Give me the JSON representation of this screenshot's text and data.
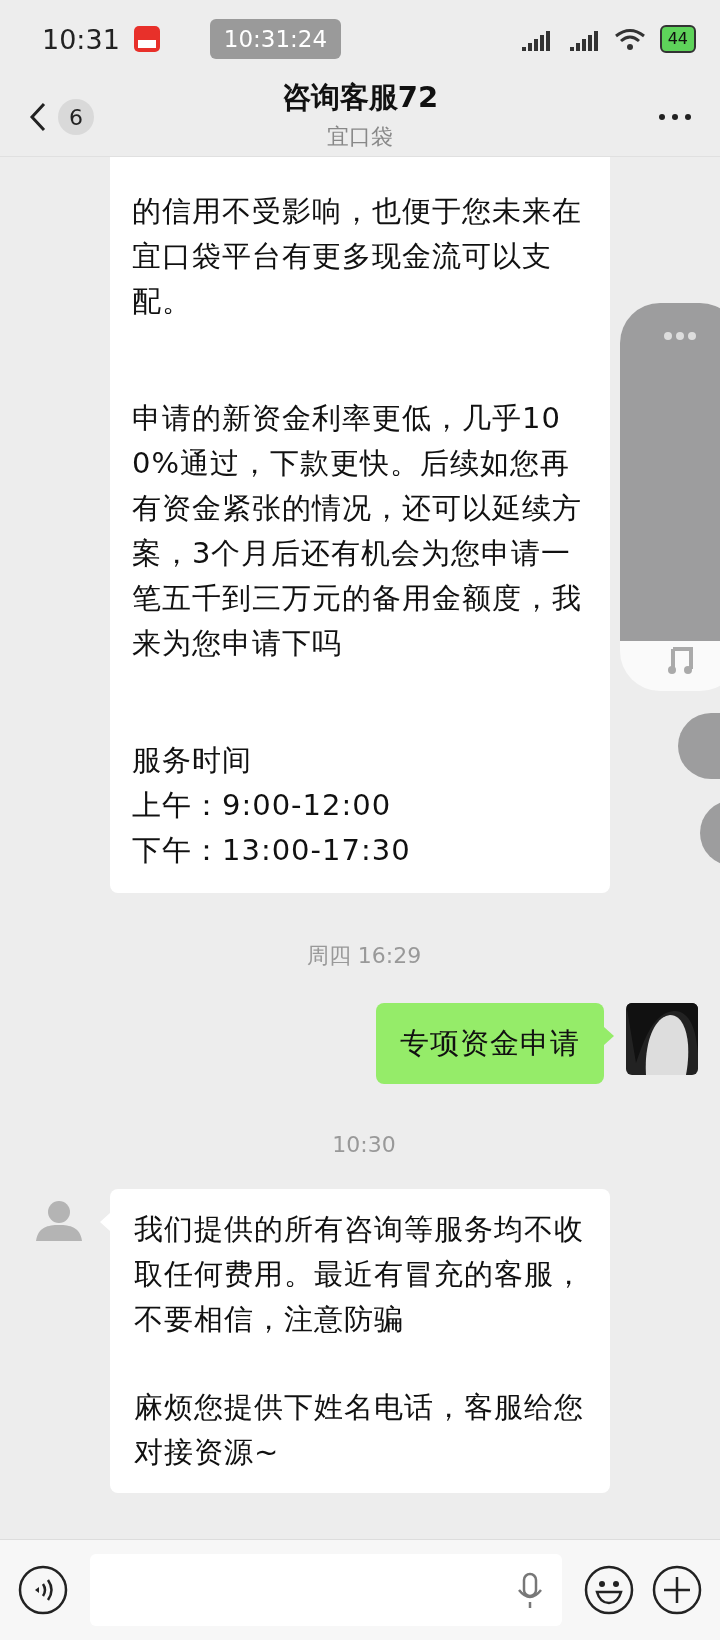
{
  "status_bar": {
    "time": "10:31",
    "recording_time": "10:31:24",
    "battery": "44"
  },
  "header": {
    "unread_count": "6",
    "title": "咨询客服72",
    "subtitle": "宜口袋"
  },
  "messages": [
    {
      "kind": "received",
      "continued": true,
      "paragraphs": [
        {
          "lines": [
            "的信用不受影响，也便于您未来在宜口袋平台有更多现金流可以支配。"
          ]
        },
        {
          "lines": [
            "申请的新资金利率更低，几乎100%通过，下款更快。后续如您再有资金紧张的情况，还可以延续方案，3个月后还有机会为您申请一笔五千到三万元的备用金额度，我来为您申请下吗"
          ]
        },
        {
          "lines": [
            "服务时间",
            "上午：9:00-12:00",
            "下午：13:00-17:30"
          ]
        }
      ]
    },
    {
      "kind": "time",
      "text": "周四 16:29"
    },
    {
      "kind": "sent",
      "paragraphs": [
        {
          "lines": [
            "专项资金申请"
          ]
        }
      ]
    },
    {
      "kind": "time",
      "text": "10:30"
    },
    {
      "kind": "received",
      "continued": false,
      "paragraphs": [
        {
          "lines": [
            "我们提供的所有咨询等服务均不收取任何费用。最近有冒充的客服，不要相信，注意防骗"
          ]
        },
        {
          "lines": [
            "麻烦您提供下姓名电话，客服给您对接资源~"
          ]
        }
      ]
    }
  ]
}
